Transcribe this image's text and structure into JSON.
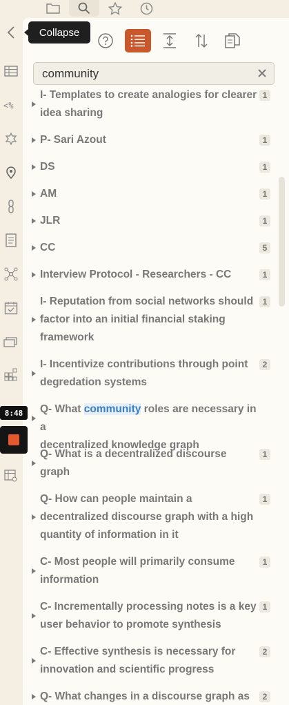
{
  "top_tabs": [
    {
      "icon": "folder-icon"
    },
    {
      "icon": "search-icon",
      "active": true
    },
    {
      "icon": "star-icon"
    },
    {
      "icon": "clock-icon"
    }
  ],
  "tooltip": {
    "text": "Collapse"
  },
  "clock_overlay": {
    "time": "8:48"
  },
  "toolbar": {
    "buttons": [
      {
        "icon": "help-icon"
      },
      {
        "icon": "list-icon",
        "active": true
      },
      {
        "icon": "expand-vertical-icon"
      },
      {
        "icon": "sort-icon"
      },
      {
        "icon": "copy-results-icon"
      }
    ]
  },
  "search": {
    "value": "community"
  },
  "results": [
    {
      "lines": [
        "I- Templates to create analogies for clearer",
        "idea sharing"
      ],
      "count": "1"
    },
    {
      "lines": [
        "P- Sari Azout"
      ],
      "count": "1"
    },
    {
      "lines": [
        "DS"
      ],
      "count": "1"
    },
    {
      "lines": [
        "AM"
      ],
      "count": "1"
    },
    {
      "lines": [
        "JLR"
      ],
      "count": "1"
    },
    {
      "lines": [
        "CC"
      ],
      "count": "5"
    },
    {
      "lines": [
        "Interview Protocol - Researchers - CC"
      ],
      "count": "1"
    },
    {
      "lines": [
        "I- Reputation from social networks should",
        "factor into an initial financial staking",
        "framework"
      ],
      "count": "1"
    },
    {
      "lines": [
        "I- Incentivize contributions through point",
        "degredation systems"
      ],
      "count": "2"
    },
    {
      "lines": [
        "Q- What community roles are necessary in a",
        "decentralized knowledge graph"
      ],
      "count": "",
      "highlight": "community"
    },
    {
      "lines": [
        "Q- What is a decentralized discourse",
        "graph"
      ],
      "count": "1"
    },
    {
      "lines": [
        "Q- How can people maintain a",
        "decentralized discourse graph with a high",
        "quantity of information in it"
      ],
      "count": "1"
    },
    {
      "lines": [
        "C- Most people will primarily consume",
        "information"
      ],
      "count": "1"
    },
    {
      "lines": [
        "C- Incrementally processing notes is a key",
        "user behavior to promote synthesis"
      ],
      "count": "1"
    },
    {
      "lines": [
        "C- Effective synthesis is necessary for",
        "innovation and scientific progress"
      ],
      "count": "2"
    },
    {
      "lines": [
        "Q- What changes in a discourse graph as"
      ],
      "count": "2"
    }
  ],
  "colors": {
    "accent": "#c9582c",
    "highlight": "#3a7fc4",
    "panel_bg": "#fdfbf5",
    "app_bg": "#f4efe2"
  }
}
